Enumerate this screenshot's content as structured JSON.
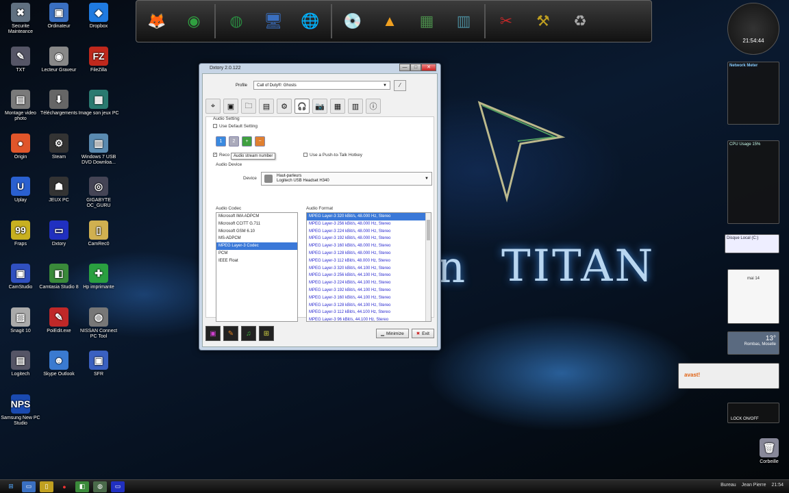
{
  "wallpaper": {
    "text_left": "n",
    "text_right": "TITAN"
  },
  "desktop_icons": [
    {
      "label": "Securite Mainteance",
      "color": "#607080",
      "glyph": "✖"
    },
    {
      "label": "Ordinateur",
      "color": "#3a6fc0",
      "glyph": "▣"
    },
    {
      "label": "Dropbox",
      "color": "#1f7ae0",
      "glyph": "◆"
    },
    {
      "label": "TXT",
      "color": "#556",
      "glyph": "✎"
    },
    {
      "label": "Lecteur Graveur",
      "color": "#888",
      "glyph": "◉"
    },
    {
      "label": "FileZilla",
      "color": "#c0281c",
      "glyph": "FZ"
    },
    {
      "label": "Montage video photo",
      "color": "#7a7a7a",
      "glyph": "▤"
    },
    {
      "label": "Téléchargements",
      "color": "#666",
      "glyph": "⬇"
    },
    {
      "label": "Image son jeux PC",
      "color": "#2a7a70",
      "glyph": "▦"
    },
    {
      "label": "Origin",
      "color": "#e0552a",
      "glyph": "●"
    },
    {
      "label": "Steam",
      "color": "#333",
      "glyph": "⚙"
    },
    {
      "label": "Windows 7 USB DVD Downloa...",
      "color": "#5a8ab0",
      "glyph": "▥"
    },
    {
      "label": "Uplay",
      "color": "#2a60d0",
      "glyph": "U"
    },
    {
      "label": "JEUX PC",
      "color": "#333",
      "glyph": "☗"
    },
    {
      "label": "GIGABYTE OC_GURU",
      "color": "#445",
      "glyph": "◎"
    },
    {
      "label": "Fraps",
      "color": "#c8b020",
      "glyph": "99"
    },
    {
      "label": "Dxtory",
      "color": "#2030c0",
      "glyph": "▭"
    },
    {
      "label": "CamRec0",
      "color": "#d0b050",
      "glyph": "▯"
    },
    {
      "label": "CamStudio",
      "color": "#3050c0",
      "glyph": "▣"
    },
    {
      "label": "Camtasia Studio 8",
      "color": "#3a8a3a",
      "glyph": "◧"
    },
    {
      "label": "Hp imprimante",
      "color": "#2aa040",
      "glyph": "✚"
    },
    {
      "label": "Snagit 10",
      "color": "#aaa",
      "glyph": "▨"
    },
    {
      "label": "PoiEdit.exe",
      "color": "#c02828",
      "glyph": "✎"
    },
    {
      "label": "NISSAN Connect PC Tool",
      "color": "#777",
      "glyph": "◍"
    },
    {
      "label": "Logitech",
      "color": "#556",
      "glyph": "▤"
    },
    {
      "label": "Skype Outlook",
      "color": "#3a7ad0",
      "glyph": "☻"
    },
    {
      "label": "SFR",
      "color": "#3a60c0",
      "glyph": "▣"
    },
    {
      "label": "Samsung New PC Studio",
      "color": "#1a4ab0",
      "glyph": "NPS"
    }
  ],
  "dock": {
    "items": [
      {
        "name": "firefox-icon",
        "glyph": "🦊",
        "color": "#e08020"
      },
      {
        "name": "chrome-icon",
        "glyph": "◉",
        "color": "#30a040"
      },
      {
        "name": "camtasia-icon",
        "glyph": "◍",
        "color": "#2a8a40"
      },
      {
        "name": "computer-icon",
        "glyph": "🖥",
        "color": "#3a6fc0"
      },
      {
        "name": "network-icon",
        "glyph": "🌐",
        "color": "#3a6fc0"
      },
      {
        "name": "disc-icon",
        "glyph": "💿",
        "color": "#888"
      },
      {
        "name": "vlc-icon",
        "glyph": "▲",
        "color": "#f0a020"
      },
      {
        "name": "images-icon",
        "glyph": "▦",
        "color": "#4a8a4a"
      },
      {
        "name": "library-icon",
        "glyph": "▥",
        "color": "#4a8a9a"
      },
      {
        "name": "tools-icon",
        "glyph": "✂",
        "color": "#c02828"
      },
      {
        "name": "tools2-icon",
        "glyph": "⚒",
        "color": "#c0a020"
      },
      {
        "name": "recycle-icon",
        "glyph": "♻",
        "color": "#aaa"
      }
    ]
  },
  "dxtory": {
    "title": "Dxtory 2.0.122",
    "profile_label": "Profile",
    "profile_value": "Call of Duty®: Ghosts",
    "tabs": [
      "⌖",
      "▣",
      "🗀",
      "▤",
      "⚙",
      "🎧",
      "📷",
      "▦",
      "▥",
      "ⓘ"
    ],
    "audio_setting_label": "Audio Setting",
    "use_default_label": "Use Default Setting",
    "record_label": "Reco",
    "push_to_talk_label": "Use a Push-to-Talk Hotkey",
    "tooltip": "Audio stream number",
    "audio_device_label": "Audio Device",
    "device_label": "Device",
    "device_line1": "Haut-parleurs",
    "device_line2": "Logitech USB Headset H340",
    "audio_codec_label": "Audio Codec",
    "codecs": [
      "Microsoft IMA ADPCM",
      "Microsoft CCITT G.711",
      "Microsoft GSM 6.10",
      "MS-ADPCM",
      "MPEG Layer-3 Codec",
      "PCM",
      "IEEE Float"
    ],
    "codec_selected": 4,
    "audio_format_label": "Audio Format",
    "formats": [
      "MPEG Layer-3 320 kBit/s, 48.000 Hz, Stereo",
      "MPEG Layer-3 256 kBit/s, 48.000 Hz, Stereo",
      "MPEG Layer-3 224 kBit/s, 48.000 Hz, Stereo",
      "MPEG Layer-3 192 kBit/s, 48.000 Hz, Stereo",
      "MPEG Layer-3 160 kBit/s, 48.000 Hz, Stereo",
      "MPEG Layer-3 128 kBit/s, 48.000 Hz, Stereo",
      "MPEG Layer-3 112 kBit/s, 48.000 Hz, Stereo",
      "MPEG Layer-3 320 kBit/s, 44.100 Hz, Stereo",
      "MPEG Layer-3 256 kBit/s, 44.100 Hz, Stereo",
      "MPEG Layer-3 224 kBit/s, 44.100 Hz, Stereo",
      "MPEG Layer-3 192 kBit/s, 44.100 Hz, Stereo",
      "MPEG Layer-3 160 kBit/s, 44.100 Hz, Stereo",
      "MPEG Layer-3 128 kBit/s, 44.100 Hz, Stereo",
      "MPEG Layer-3 112 kBit/s, 44.100 Hz, Stereo",
      "MPEG Layer-3 96 kBit/s, 44.100 Hz, Stereo"
    ],
    "format_selected": 0,
    "minimize_label": "Minimize",
    "exit_label": "Exit"
  },
  "gadgets": {
    "clock_time": "21:54:44",
    "network_title": "Network Meter",
    "cpu_title": "CPU Usage",
    "cpu_percent": "15%",
    "disk_label": "Disque Local (C:)",
    "calendar_month": "mai 14",
    "weather_temp": "13°",
    "weather_city": "Rombas, Moselle",
    "avast_label": "avast!",
    "lock_label": "LOCK ON/OFF",
    "recycle_label": "Corbeille"
  },
  "taskbar": {
    "desktop_label": "Bureau",
    "user": "Jean Pierre",
    "time": "21:54"
  }
}
